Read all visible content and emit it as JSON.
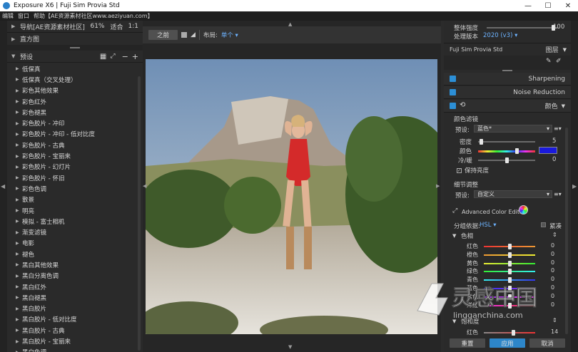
{
  "window": {
    "title": "Exposure X6 | Fuji Sim Provia Std"
  },
  "menu": [
    "编辑",
    "窗口",
    "帮助【AE资源素材社区www.aeziyuan.com】"
  ],
  "left": {
    "navigator": {
      "label": "导航[AE资源素材社区]",
      "zoom": "61%",
      "fit": "适合",
      "ratio": "1:1"
    },
    "histogram": "直方图",
    "presets_label": "预设",
    "presets": [
      "低保真",
      "低保真（交叉处理）",
      "彩色其他效果",
      "彩色红外",
      "彩色褪黑",
      "彩色胶片 - 冲印",
      "彩色胶片 - 冲印 - 低对比度",
      "彩色胶片 - 古典",
      "彩色胶片 - 宝丽来",
      "彩色胶片 - 幻灯片",
      "彩色胶片 - 怀旧",
      "彩色色调",
      "散景",
      "明亮",
      "模拟 - 富士相机",
      "渐变滤镜",
      "电影",
      "褪色",
      "黑白其他效果",
      "黑白分离色调",
      "黑白红外",
      "黑白褪黑",
      "黑白胶片",
      "黑白胶片 - 低对比度",
      "黑白胶片 - 古典",
      "黑白胶片 - 宝丽来",
      "黑白色调"
    ]
  },
  "toolbar": {
    "before": "之前",
    "layout_label": "布局:",
    "layout_value": "单个"
  },
  "right": {
    "overall_strength_label": "整体强度",
    "overall_strength_value": "100",
    "overall_strength": 0.93,
    "process_label": "处理版本",
    "process_value": "2020 (v3)",
    "layer_name": "Fuji Sim Provia Std",
    "layers_label": "图层",
    "sections": {
      "sharpening": "Sharpening",
      "noise": "Noise Reduction",
      "color": "颜色"
    },
    "color_filter": {
      "title": "颜色滤镜",
      "preset_label": "预设:",
      "preset_value": "蓝色*",
      "density_label": "密度",
      "density_value": "5",
      "density": 0.05,
      "color_label": "颜色",
      "color_swatch": "#1a1adc",
      "color_pos": 0.68,
      "warmth_label": "冷/暖",
      "warmth_value": "0",
      "warmth": 0.5,
      "keep_brightness": "保持亮度"
    },
    "detail": {
      "title": "细节调整",
      "preset_label": "预设:",
      "preset_value": "自定义"
    },
    "ace": "Advanced Color Editor",
    "group_label": "分组依据:",
    "group_value": "HSL",
    "compact": "紧凑",
    "hue_title": "色相",
    "hues": [
      {
        "label": "红色",
        "value": "0"
      },
      {
        "label": "橙色",
        "value": "0"
      },
      {
        "label": "黄色",
        "value": "0"
      },
      {
        "label": "绿色",
        "value": "0"
      },
      {
        "label": "青色",
        "value": "0"
      },
      {
        "label": "蓝色",
        "value": "0"
      },
      {
        "label": "紫色",
        "value": "0"
      },
      {
        "label": "洋红",
        "value": "0"
      }
    ],
    "sat_title": "饱和度",
    "sat_red_label": "红色",
    "sat_red_value": "14",
    "sat_red": 0.57,
    "buttons": {
      "reset": "重置",
      "apply": "应用",
      "cancel": "取消"
    }
  },
  "watermark": {
    "text": "灵感中国",
    "url": "lingganchina.com"
  },
  "colors": {
    "accent": "#2c8fd6",
    "apply_button": "#2d86c9"
  }
}
